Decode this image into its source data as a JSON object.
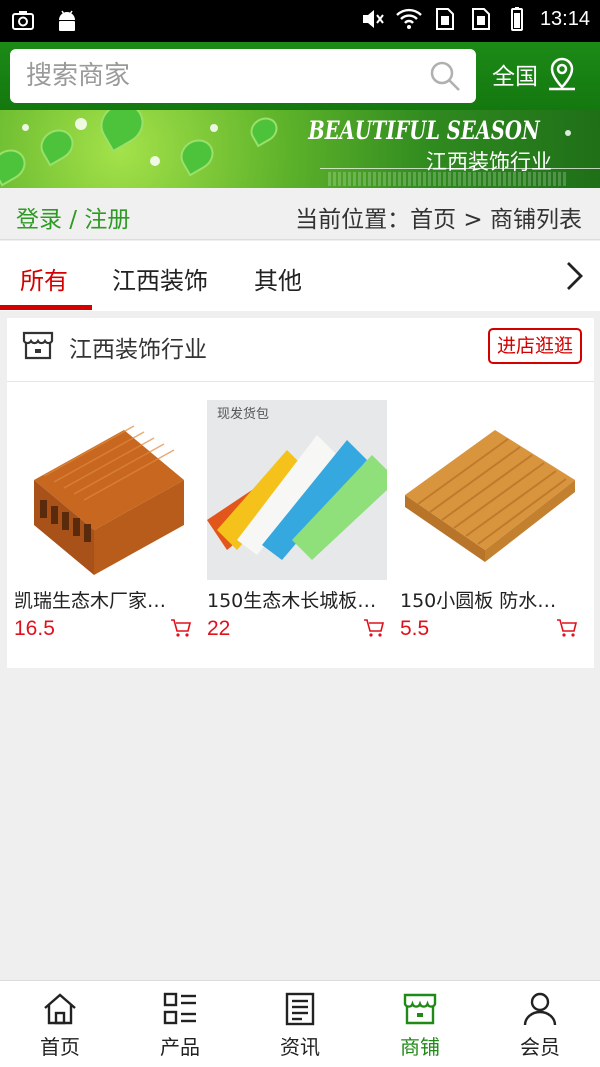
{
  "status_bar": {
    "time": "13:14",
    "icons": [
      "screenshot-icon",
      "android-icon",
      "mute-icon",
      "wifi-icon",
      "sim1-icon",
      "sim2-icon",
      "battery-icon"
    ]
  },
  "header": {
    "search_placeholder": "搜索商家",
    "region_label": "全国",
    "accent_color": "#1a8614"
  },
  "banner": {
    "title": "BEAUTIFUL SEASON",
    "subtitle": "江西装饰行业"
  },
  "breadcrumb": {
    "login_label": "登录 / 注册",
    "location_label": "当前位置：首页 > 商铺列表"
  },
  "tabs": [
    {
      "label": "所有",
      "active": true
    },
    {
      "label": "江西装饰",
      "active": false
    },
    {
      "label": "其他",
      "active": false
    }
  ],
  "store": {
    "name": "江西装饰行业",
    "visit_label": "进店逛逛",
    "products": [
      {
        "name": "凯瑞生态木厂家…",
        "price": "16.5"
      },
      {
        "name": "150生态木长城板…",
        "price": "22"
      },
      {
        "name": "150小圆板 防水…",
        "price": "5.5"
      }
    ],
    "product2_image_text": "现发货包"
  },
  "bottom_nav": [
    {
      "label": "首页",
      "icon": "home-icon",
      "active": false
    },
    {
      "label": "产品",
      "icon": "products-icon",
      "active": false
    },
    {
      "label": "资讯",
      "icon": "news-icon",
      "active": false
    },
    {
      "label": "商铺",
      "icon": "store-icon",
      "active": true
    },
    {
      "label": "会员",
      "icon": "user-icon",
      "active": false
    }
  ],
  "colors": {
    "active_red": "#d40000",
    "price_red": "#e0111c",
    "brand_green": "#1f8a16"
  }
}
